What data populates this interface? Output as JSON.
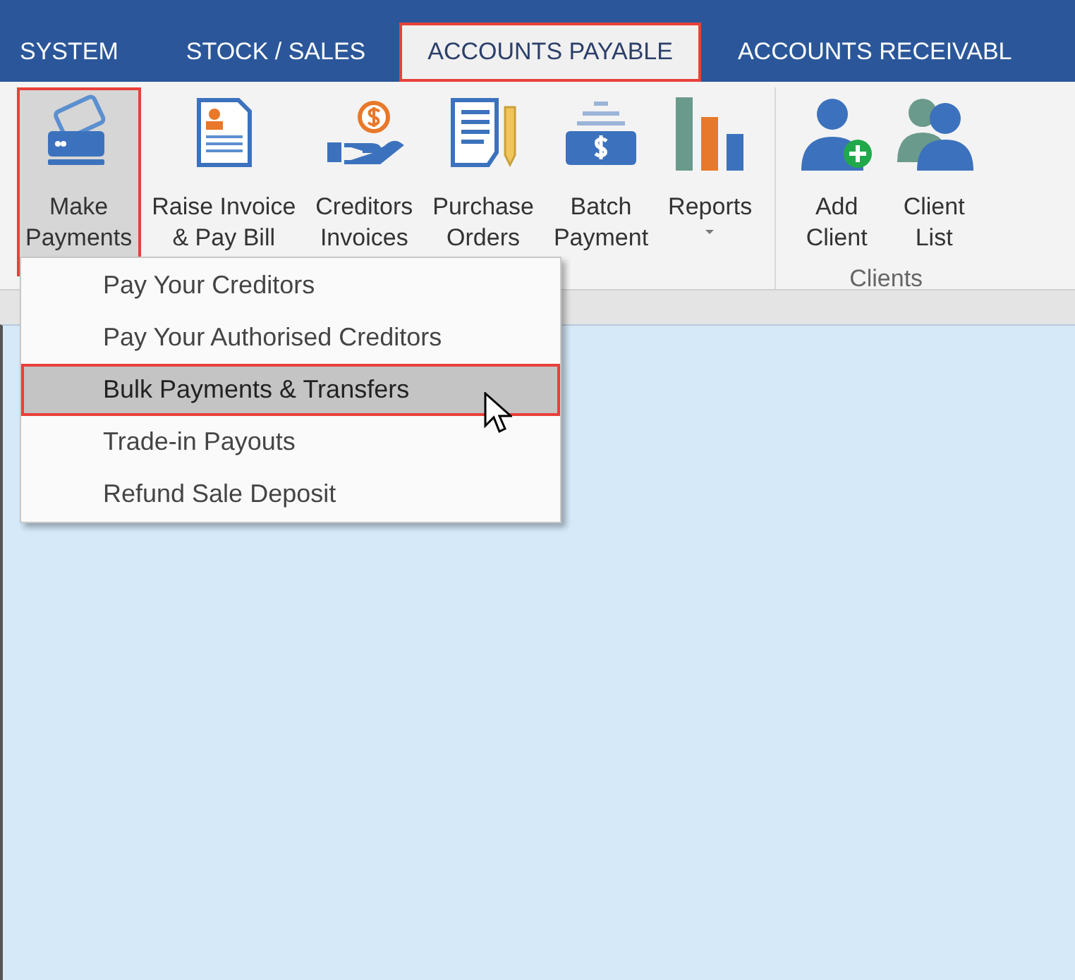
{
  "tabs": [
    {
      "label": "SYSTEM",
      "selected": false,
      "outlined": false
    },
    {
      "label": "STOCK / SALES",
      "selected": false,
      "outlined": false
    },
    {
      "label": "ACCOUNTS PAYABLE",
      "selected": true,
      "outlined": true
    },
    {
      "label": "ACCOUNTS RECEIVABL",
      "selected": false,
      "outlined": false
    }
  ],
  "ribbon": {
    "groups": [
      {
        "buttons": [
          {
            "kind": "cards",
            "label": "Make\nPayments",
            "dropdown": true,
            "pressed": true,
            "outlined": true
          },
          {
            "kind": "invoice",
            "label": "Raise Invoice\n& Pay Bill",
            "dropdown": false,
            "pressed": false,
            "outlined": false
          },
          {
            "kind": "hand-coin",
            "label": "Creditors\nInvoices",
            "dropdown": false,
            "pressed": false,
            "outlined": false
          },
          {
            "kind": "document-pencil",
            "label": "Purchase\nOrders",
            "dropdown": false,
            "pressed": false,
            "outlined": false
          },
          {
            "kind": "money-tray",
            "label": "Batch\nPayment",
            "dropdown": false,
            "pressed": false,
            "outlined": false
          },
          {
            "kind": "bar-chart",
            "label": "Reports",
            "dropdown": true,
            "pressed": false,
            "outlined": false
          }
        ]
      },
      {
        "label": "Clients",
        "buttons": [
          {
            "kind": "person-add",
            "label": "Add\nClient",
            "dropdown": false,
            "pressed": false,
            "outlined": false
          },
          {
            "kind": "people",
            "label": "Client\nList",
            "dropdown": false,
            "pressed": false,
            "outlined": false
          }
        ]
      }
    ]
  },
  "menu": {
    "items": [
      {
        "label": "Pay Your Creditors",
        "selected": false,
        "outlined": false
      },
      {
        "label": "Pay Your Authorised Creditors",
        "selected": false,
        "outlined": false
      },
      {
        "label": "Bulk Payments & Transfers",
        "selected": true,
        "outlined": true
      },
      {
        "label": "Trade-in Payouts",
        "selected": false,
        "outlined": false
      },
      {
        "label": "Refund Sale Deposit",
        "selected": false,
        "outlined": false
      }
    ]
  }
}
